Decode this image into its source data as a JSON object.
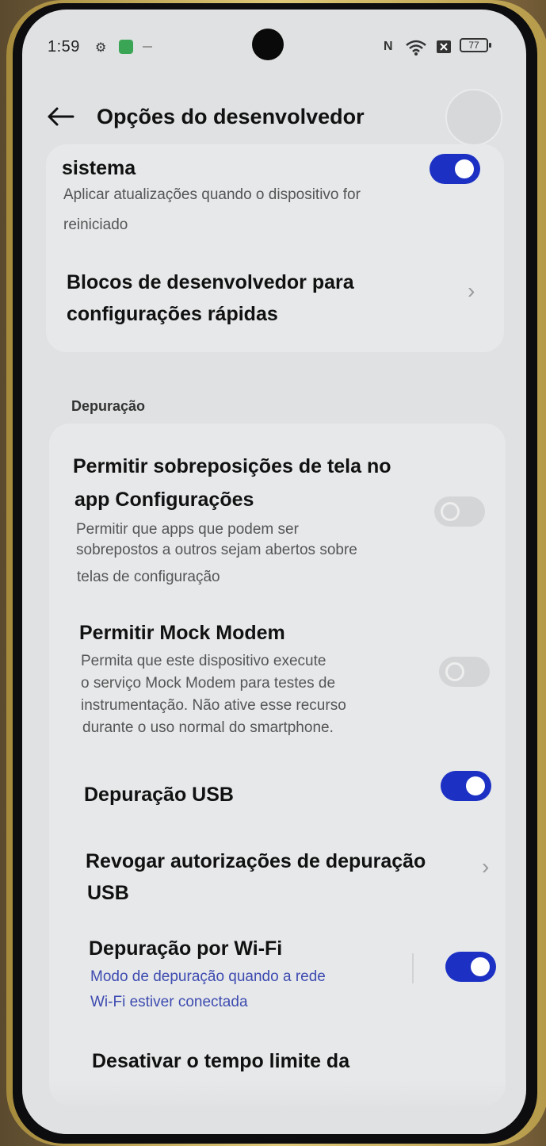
{
  "status_bar": {
    "time": "1:59",
    "battery": "77",
    "icons": [
      "settings-gear-icon",
      "app-notification-icon",
      "nfc-icon",
      "wifi-icon",
      "no-sim-icon",
      "battery-icon"
    ]
  },
  "header": {
    "title": "Opções do desenvolvedor",
    "back_icon": "arrow-left-icon"
  },
  "rows": {
    "system_updates": {
      "title": "sistema",
      "subtitle_line1": "Aplicar atualizações quando o dispositivo for",
      "subtitle_line2": "reiniciado",
      "toggle": "on"
    },
    "quick_settings_tiles": {
      "title_line1": "Blocos de desenvolvedor para",
      "title_line2": "configurações rápidas"
    }
  },
  "section_debug": {
    "label": "Depuração",
    "overlays": {
      "title_line1": "Permitir sobreposições de tela no",
      "title_line2": "app Configurações",
      "subtitle_line1": "Permitir que apps que podem ser",
      "subtitle_line2": "sobrepostos a outros sejam abertos sobre",
      "subtitle_line3": "telas de configuração",
      "toggle": "off"
    },
    "mock_modem": {
      "title": "Permitir Mock Modem",
      "subtitle_line1": "Permita que este dispositivo execute",
      "subtitle_line2": "o serviço Mock Modem para testes de",
      "subtitle_line3": "instrumentação. Não ative esse recurso",
      "subtitle_line4": "durante o uso normal do smartphone.",
      "toggle": "off"
    },
    "usb_debug": {
      "title": "Depuração USB",
      "toggle": "on"
    },
    "revoke_usb": {
      "title_line1": "Revogar autorizações de depuração",
      "title_line2": "USB"
    },
    "wifi_debug": {
      "title": "Depuração por Wi-Fi",
      "subtitle_line1": "Modo de depuração quando a rede",
      "subtitle_line2": "Wi-Fi estiver conectada",
      "toggle": "on"
    },
    "timeout": {
      "title": "Desativar o tempo limite da"
    }
  },
  "colors": {
    "accent": "#1c31c4",
    "link_text": "#3e4bb0",
    "background": "#dfe1e3",
    "card": "#e6e8ea"
  }
}
